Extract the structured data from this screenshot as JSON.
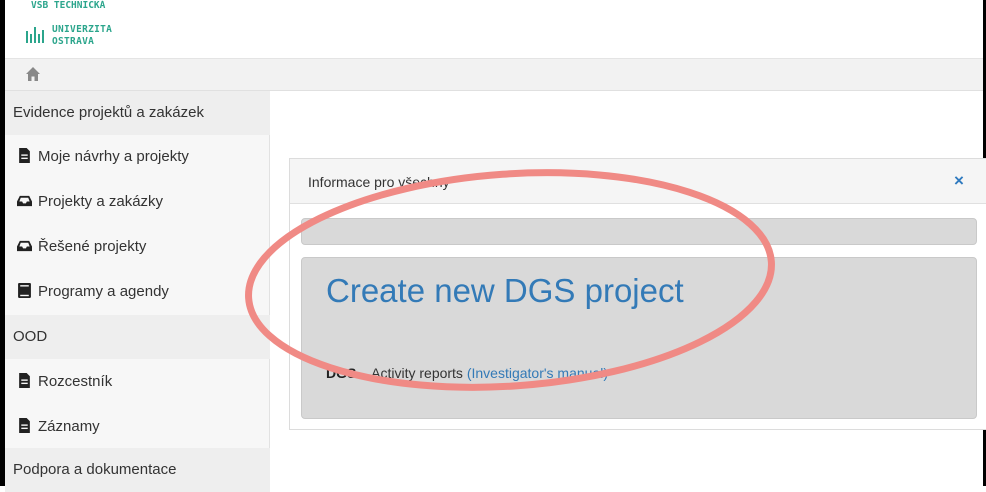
{
  "header": {
    "logo_line1": "VŠB TECHNICKÁ",
    "logo_line2": "UNIVERZITA",
    "logo_line3": "OSTRAVA",
    "logo_color": "#2ba58c"
  },
  "homebar": {
    "icon": "home-icon"
  },
  "sidebar": {
    "sections": [
      {
        "label": "Evidence projektů a zakázek"
      },
      {
        "label": "OOD"
      },
      {
        "label": "Podpora a dokumentace"
      }
    ],
    "items": [
      {
        "label": "Moje návrhy a projekty",
        "icon": "file-icon"
      },
      {
        "label": "Projekty a zakázky",
        "icon": "inbox-icon"
      },
      {
        "label": "Řešené projekty",
        "icon": "inbox-icon"
      },
      {
        "label": "Programy a agendy",
        "icon": "book-icon"
      },
      {
        "label": "Rozcestník",
        "icon": "file-icon"
      },
      {
        "label": "Záznamy",
        "icon": "file-icon"
      }
    ]
  },
  "panel": {
    "title": "Informace pro všechny",
    "close_label": "×",
    "jumbo_link": "Create new DGS project",
    "line_prefix": "DGS",
    "line_dash": " – Activity reports ",
    "line_link": "(Investigator's manual)"
  },
  "colors": {
    "accent": "#337ab7",
    "annotation": "#f08a85"
  }
}
